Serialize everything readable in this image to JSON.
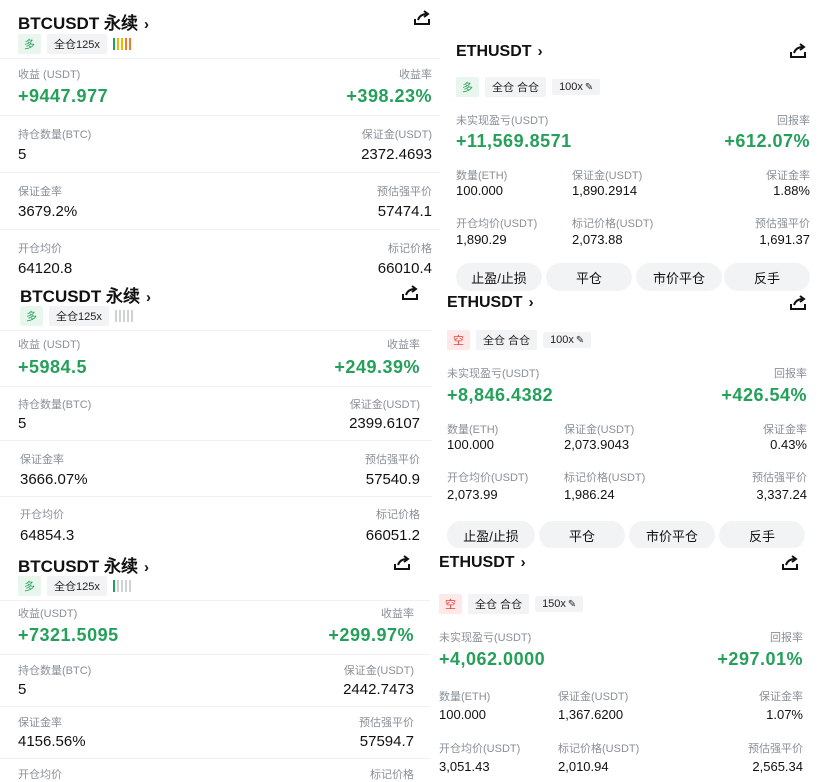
{
  "colors": {
    "profit": "#25a05a",
    "long_bg": "#e9f6ee",
    "short": "#e0453b",
    "short_bg": "#fde9e9",
    "label": "#8a8f98"
  },
  "btc_cards": [
    {
      "title": "BTCUSDT 永续",
      "side": "多",
      "margin_mode": "全仓125x",
      "pnl_label": "收益 (USDT)",
      "pnl": "+9447.977",
      "roe_label": "收益率",
      "roe": "+398.23%",
      "qty_label": "持仓数量(BTC)",
      "qty": "5",
      "margin_label": "保证金(USDT)",
      "margin": "2372.4693",
      "mr_label": "保证金率",
      "mr": "3679.2%",
      "liq_label": "预估强平价",
      "liq": "57474.1",
      "entry_label": "开仓均价",
      "entry": "64120.8",
      "mark_label": "标记价格",
      "mark": "66010.4"
    },
    {
      "title": "BTCUSDT 永续",
      "side": "多",
      "margin_mode": "全仓125x",
      "pnl_label": "收益 (USDT)",
      "pnl": "+5984.5",
      "roe_label": "收益率",
      "roe": "+249.39%",
      "qty_label": "持仓数量(BTC)",
      "qty": "5",
      "margin_label": "保证金(USDT)",
      "margin": "2399.6107",
      "mr_label": "保证金率",
      "mr": "3666.07%",
      "liq_label": "预估强平价",
      "liq": "57540.9",
      "entry_label": "开仓均价",
      "entry": "64854.3",
      "mark_label": "标记价格",
      "mark": "66051.2"
    },
    {
      "title": "BTCUSDT 永续",
      "side": "多",
      "margin_mode": "全仓125x",
      "pnl_label": "收益(USDT)",
      "pnl": "+7321.5095",
      "roe_label": "收益率",
      "roe": "+299.97%",
      "qty_label": "持仓数量(BTC)",
      "qty": "5",
      "margin_label": "保证金(USDT)",
      "margin": "2442.7473",
      "mr_label": "保证金率",
      "mr": "4156.56%",
      "liq_label": "预估强平价",
      "liq": "57594.7",
      "entry_label": "开仓均价",
      "entry": "",
      "mark_label": "标记价格",
      "mark": ""
    }
  ],
  "eth_cards": [
    {
      "title": "ETHUSDT",
      "side": "多",
      "mode": "全仓 合仓",
      "leverage": "100x",
      "pnl_label": "未实现盈亏(USDT)",
      "pnl": "+11,569.8571",
      "roe_label": "回报率",
      "roe": "+612.07%",
      "qty_label": "数量(ETH)",
      "qty": "100.000",
      "margin_label": "保证金(USDT)",
      "margin": "1,890.2914",
      "mr_label": "保证金率",
      "mr": "1.88%",
      "entry_label": "开仓均价(USDT)",
      "entry": "1,890.29",
      "mark_label": "标记价格(USDT)",
      "mark": "2,073.88",
      "liq_label": "预估强平价",
      "liq": "1,691.37",
      "buttons": [
        "止盈/止损",
        "平仓",
        "市价平仓",
        "反手"
      ]
    },
    {
      "title": "ETHUSDT",
      "side": "空",
      "mode": "全仓 合仓",
      "leverage": "100x",
      "pnl_label": "未实现盈亏(USDT)",
      "pnl": "+8,846.4382",
      "roe_label": "回报率",
      "roe": "+426.54%",
      "qty_label": "数量(ETH)",
      "qty": "100.000",
      "margin_label": "保证金(USDT)",
      "margin": "2,073.9043",
      "mr_label": "保证金率",
      "mr": "0.43%",
      "entry_label": "开仓均价(USDT)",
      "entry": "2,073.99",
      "mark_label": "标记价格(USDT)",
      "mark": "1,986.24",
      "liq_label": "预估强平价",
      "liq": "3,337.24",
      "buttons": [
        "止盈/止损",
        "平仓",
        "市价平仓",
        "反手"
      ]
    },
    {
      "title": "ETHUSDT",
      "side": "空",
      "mode": "全仓 合仓",
      "leverage": "150x",
      "pnl_label": "未实现盈亏(USDT)",
      "pnl": "+4,062.0000",
      "roe_label": "回报率",
      "roe": "+297.01%",
      "qty_label": "数量(ETH)",
      "qty": "100.000",
      "margin_label": "保证金(USDT)",
      "margin": "1,367.6200",
      "mr_label": "保证金率",
      "mr": "1.07%",
      "entry_label": "开仓均价(USDT)",
      "entry": "3,051.43",
      "mark_label": "标记价格(USDT)",
      "mark": "2,010.94",
      "liq_label": "预估强平价",
      "liq": "2,565.34",
      "buttons": []
    }
  ]
}
